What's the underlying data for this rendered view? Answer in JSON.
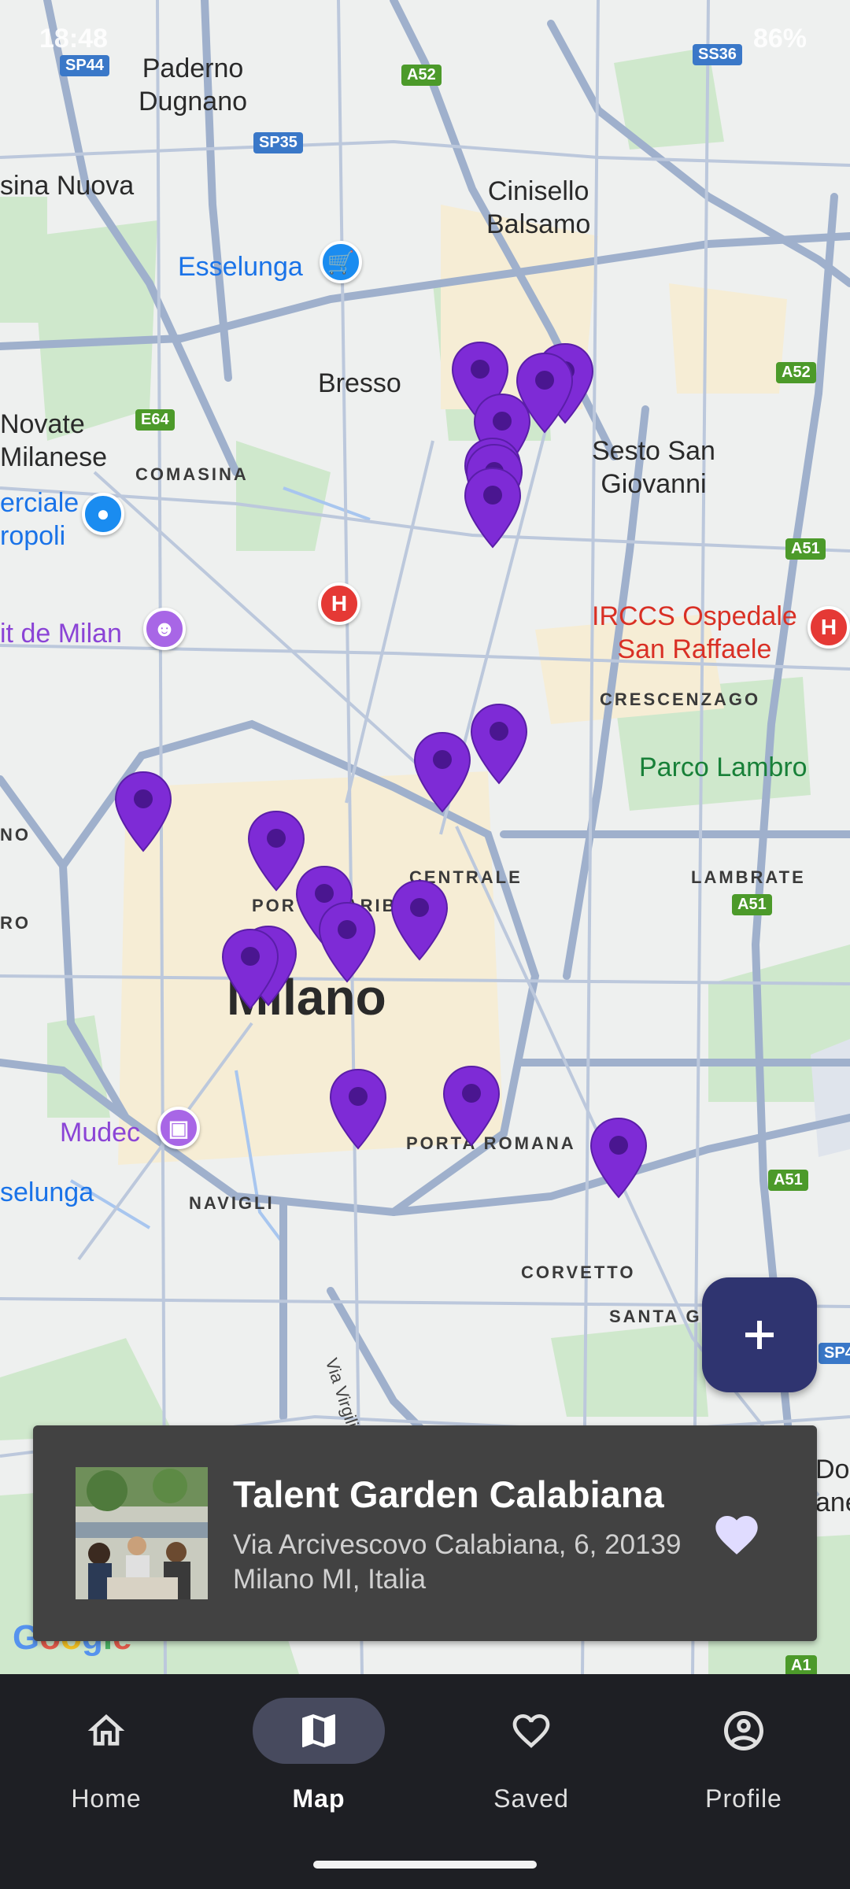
{
  "status_bar": {
    "time": "18:48",
    "battery": "86%"
  },
  "map": {
    "labels": {
      "paderno": "Paderno\nDugnano",
      "cinisello": "Cinisello\nBalsamo",
      "sina_nuova": "sina Nuova",
      "bresso": "Bresso",
      "novate": "Novate\nMilanese",
      "comasina": "COMASINA",
      "sesto": "Sesto San\nGiovanni",
      "irccs": "IRCCS Ospedale\nSan Raffaele",
      "crescenzago": "CRESCENZAGO",
      "parco_lambro": "Parco Lambro",
      "lambrate": "LAMBRATE",
      "centrale": "CENTRALE",
      "porta_garibaldi": "PORTA GARIBALDI",
      "milano": "Milano",
      "porta_romana": "PORTA ROMANA",
      "navigli": "NAVIGLI",
      "corvetto": "CORVETTO",
      "santa_giulia": "SANTA GI",
      "via_virgilio": "Via Virgilio Ferrari",
      "esselunga_top": "Esselunga",
      "esselunga_bottom": "selunga",
      "merciale": "erciale\nropoli",
      "milan_poi": "it de Milan",
      "mudec": "Mudec",
      "no_left": "NO",
      "ro_left": "RO",
      "do_right": "Do\nane"
    },
    "shields": {
      "sp44": "SP44",
      "a52_top": "A52",
      "sp35": "SP35",
      "e64": "E64",
      "a52_right": "A52",
      "a51_right": "A51",
      "a51_mid": "A51",
      "a51_low": "A51",
      "ss36": "SS36",
      "sp4": "SP4",
      "a1": "A1"
    },
    "google_logo": "Google"
  },
  "fab": {
    "icon": "plus-icon"
  },
  "card": {
    "title": "Talent Garden Calabiana",
    "address": "Via Arcivescovo Calabiana, 6, 20139 Milano MI, Italia",
    "heart_icon": "heart-filled-icon",
    "accent": "#e0dcff"
  },
  "nav": {
    "items": [
      {
        "label": "Home",
        "icon": "home-icon"
      },
      {
        "label": "Map",
        "icon": "map-icon",
        "active": true
      },
      {
        "label": "Saved",
        "icon": "heart-outline-icon"
      },
      {
        "label": "Profile",
        "icon": "account-circle-icon"
      }
    ]
  },
  "colors": {
    "pin": "#7e2bd6",
    "pin_dot": "#4a1690",
    "fab": "#2f3470",
    "navbar": "#1e1f24"
  }
}
